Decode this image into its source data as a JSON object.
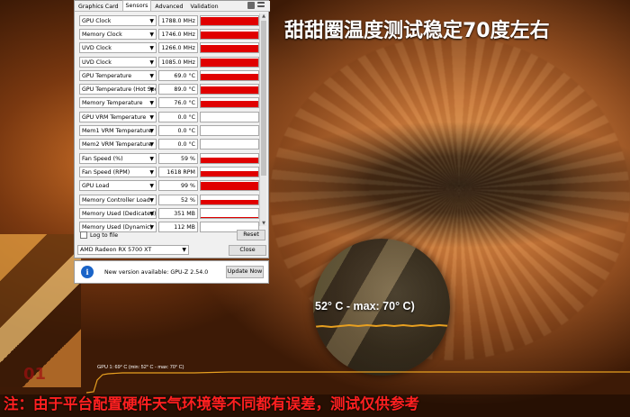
{
  "headline": "甜甜圈温度测试稳定70度左右",
  "gpuz": {
    "tabs": [
      {
        "label": "Graphics Card",
        "active": false
      },
      {
        "label": "Sensors",
        "active": true
      },
      {
        "label": "Advanced",
        "active": false
      },
      {
        "label": "Validation",
        "active": false
      }
    ],
    "sensors": [
      {
        "label": "GPU Clock",
        "value": "1788.0 MHz",
        "level": 0.82
      },
      {
        "label": "Memory Clock",
        "value": "1746.0 MHz",
        "level": 0.82
      },
      {
        "label": "UVD Clock",
        "value": "1266.0 MHz",
        "level": 0.82
      },
      {
        "label": "UVD Clock",
        "value": "1085.0 MHz",
        "level": 0.82
      },
      {
        "label": "GPU Temperature",
        "value": "69.0 °C",
        "level": 0.7
      },
      {
        "label": "GPU Temperature (Hot Spot)",
        "value": "89.0 °C",
        "level": 0.8
      },
      {
        "label": "Memory Temperature",
        "value": "76.0 °C",
        "level": 0.75
      },
      {
        "label": "GPU VRM Temperature",
        "value": "0.0 °C",
        "level": 0
      },
      {
        "label": "Mem1 VRM Temperature",
        "value": "0.0 °C",
        "level": 0
      },
      {
        "label": "Mem2 VRM Temperature",
        "value": "0.0 °C",
        "level": 0
      },
      {
        "label": "Fan Speed (%)",
        "value": "59 %",
        "level": 0.55
      },
      {
        "label": "Fan Speed (RPM)",
        "value": "1618 RPM",
        "level": 0.55
      },
      {
        "label": "GPU Load",
        "value": "99 %",
        "level": 0.88
      },
      {
        "label": "Memory Controller Load",
        "value": "52 %",
        "level": 0.5
      },
      {
        "label": "Memory Used (Dedicated)",
        "value": "351 MB",
        "level": 0.12
      },
      {
        "label": "Memory Used (Dynamic)",
        "value": "112 MB",
        "level": 0.05
      }
    ],
    "log_label": "Log to file",
    "reset_label": "Reset",
    "card_name": "AMD Radeon RX 5700 XT",
    "close_label": "Close"
  },
  "update": {
    "icon_letter": "i",
    "text": "New version available: GPU-Z 2.54.0",
    "button_label": "Update Now"
  },
  "magnifier_text": "52° C - max: 70° C)",
  "osd_text": "GPU 1: 69° C (min: 52° C - max: 70° C)",
  "left_digits": "01",
  "footer_note": "注：由于平台配置硬件天气环境等不同都有误差，测试仅供参考",
  "colors": {
    "graph_red": "#e00000",
    "osd_line": "#e8a020",
    "footer_text": "#ff2020",
    "info_blue": "#1a64c8"
  }
}
